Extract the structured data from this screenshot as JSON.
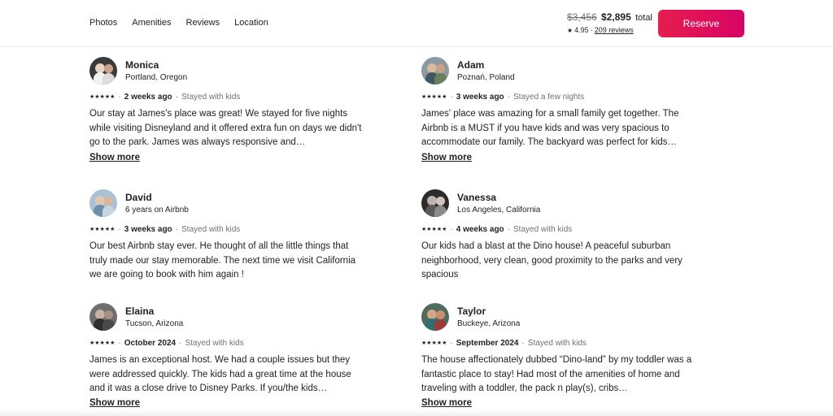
{
  "nav": {
    "items": [
      "Photos",
      "Amenities",
      "Reviews",
      "Location"
    ]
  },
  "booking": {
    "old_price": "$3,456",
    "new_price": "$2,895",
    "price_suffix": "total",
    "rating": "4.95",
    "separator": "·",
    "reviews_link": "209 reviews",
    "reserve_label": "Reserve",
    "accent_color": "#e61e4d"
  },
  "reviews": [
    {
      "name": "Monica",
      "subtitle": "Portland, Oregon",
      "stars": "★★★★★",
      "when": "2 weeks ago",
      "stay": "Stayed with kids",
      "text": "Our stay at James's place was great! We stayed for five nights while visiting Disneyland and it offered extra fun on days we didn't go to the park. James was always responsive and…",
      "show_more": "Show more"
    },
    {
      "name": "Adam",
      "subtitle": "Poznań, Poland",
      "stars": "★★★★★",
      "when": "3 weeks ago",
      "stay": "Stayed a few nights",
      "text": "James' place was amazing for a small family get together. The Airbnb is a MUST if you have kids and was very spacious to accommodate our family. The backyard was perfect for kids…",
      "show_more": "Show more"
    },
    {
      "name": "David",
      "subtitle": "6 years on Airbnb",
      "stars": "★★★★★",
      "when": "3 weeks ago",
      "stay": "Stayed with kids",
      "text": "Our best Airbnb stay ever. He thought of all the little things that truly made our stay memorable. The next time we visit California we are going to book with him again !",
      "show_more": ""
    },
    {
      "name": "Vanessa",
      "subtitle": "Los Angeles, California",
      "stars": "★★★★★",
      "when": "4 weeks ago",
      "stay": "Stayed with kids",
      "text": "Our kids had a blast at the Dino house! A peaceful suburban neighborhood, very clean, good proximity to the parks and very spacious",
      "show_more": ""
    },
    {
      "name": "Elaina",
      "subtitle": "Tucson, Arizona",
      "stars": "★★★★★",
      "when": "October 2024",
      "stay": "Stayed with kids",
      "text": "James is an exceptional host. We had a couple issues but they were addressed quickly. The kids had a great time at the house and it was a close drive to Disney Parks. If you/the kids…",
      "show_more": "Show more"
    },
    {
      "name": "Taylor",
      "subtitle": "Buckeye, Arizona",
      "stars": "★★★★★",
      "when": "September 2024",
      "stay": "Stayed with kids",
      "text": "The house affectionately dubbed “Dino-land” by my toddler was a fantastic place to stay! Had most of the amenities of home and traveling with a toddler, the pack n play(s), cribs…",
      "show_more": "Show more"
    }
  ]
}
